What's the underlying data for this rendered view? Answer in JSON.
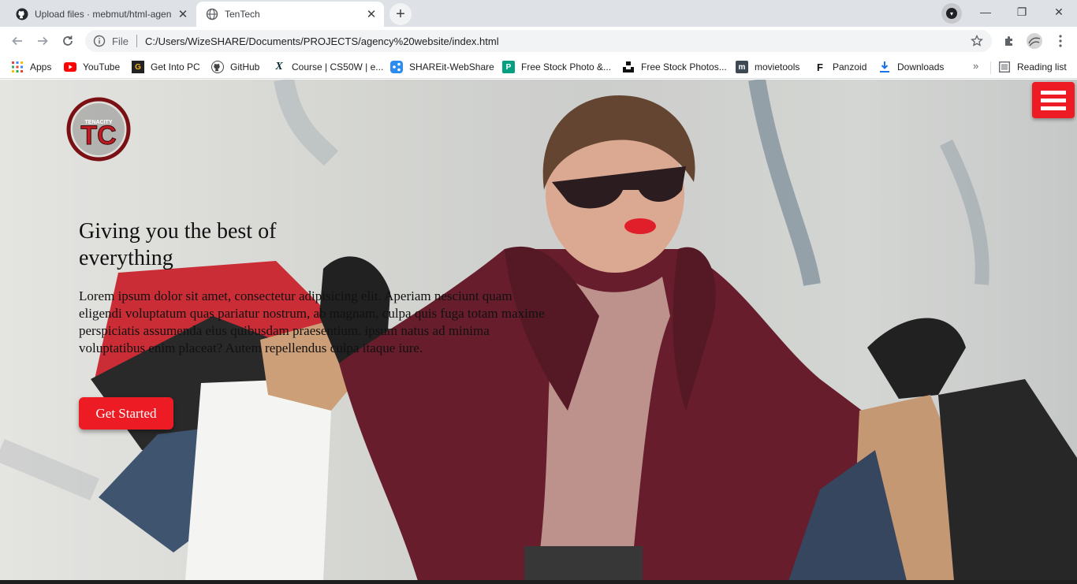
{
  "browser": {
    "tabs": [
      {
        "title": "Upload files · mebmut/html-agen",
        "icon": "github-icon"
      },
      {
        "title": "TenTech",
        "icon": "globe-icon",
        "active": true
      }
    ],
    "address": {
      "scheme": "File",
      "url": "C:/Users/WizeSHARE/Documents/PROJECTS/agency%20website/index.html"
    },
    "bookmarks": [
      {
        "label": "Apps",
        "icon": "apps-grid-icon"
      },
      {
        "label": "YouTube",
        "icon": "youtube-icon"
      },
      {
        "label": "Get Into PC",
        "icon": "getintopc-icon"
      },
      {
        "label": "GitHub",
        "icon": "github-icon"
      },
      {
        "label": "Course | CS50W | e...",
        "icon": "edx-icon"
      },
      {
        "label": "SHAREit-WebShare",
        "icon": "shareit-icon"
      },
      {
        "label": "Free Stock Photo &...",
        "icon": "pexels-icon"
      },
      {
        "label": "Free Stock Photos...",
        "icon": "unsplash-icon"
      },
      {
        "label": "movietools",
        "icon": "movietools-icon"
      },
      {
        "label": "Panzoid",
        "icon": "panzoid-icon"
      },
      {
        "label": "Downloads",
        "icon": "download-icon"
      }
    ],
    "more": "»",
    "reading_list": "Reading list"
  },
  "page": {
    "logo_text": "TENACITY",
    "logo_letters": "TC",
    "hero": {
      "title": "Giving you the best of everything",
      "body": "Lorem ipsum dolor sit amet, consectetur adipisicing elit. Aperiam nesciunt quam eligendi voluptatum quas pariatur nostrum, ab magnam, culpa quis fuga totam maxime perspiciatis assumenda eius quibusdam praesentium. ipsum natus ad minima voluptatibus enim placeat? Autem repellendus culpa itaque iure.",
      "cta": "Get Started"
    }
  },
  "colors": {
    "accent": "#ed1c24",
    "chrome": "#dee1e6"
  }
}
